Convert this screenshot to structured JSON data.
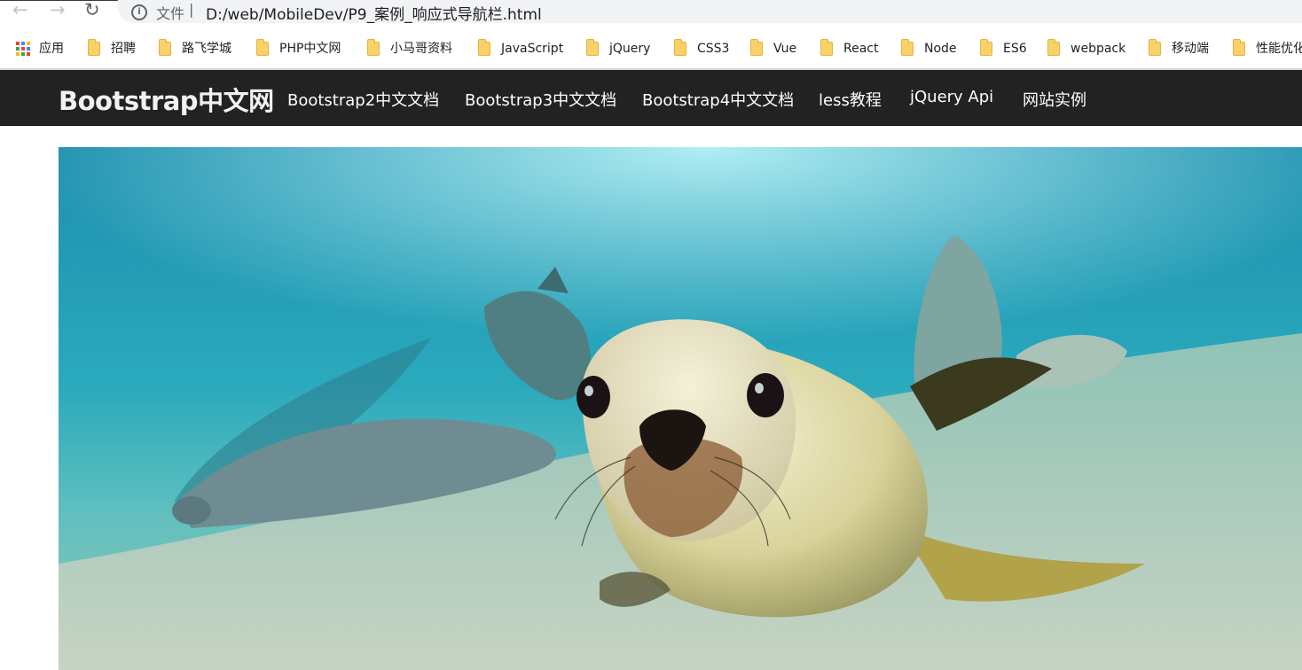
{
  "browser": {
    "address_label": "文件",
    "address_separator": "|",
    "url": "D:/web/MobileDev/P9_案例_响应式导航栏.html"
  },
  "bookmarks": {
    "apps_label": "应用",
    "items": [
      {
        "label": "招聘"
      },
      {
        "label": "路飞学城"
      },
      {
        "label": "PHP中文网"
      },
      {
        "label": "小马哥资料"
      },
      {
        "label": "JavaScript"
      },
      {
        "label": "jQuery"
      },
      {
        "label": "CSS3"
      },
      {
        "label": "Vue"
      },
      {
        "label": "React"
      },
      {
        "label": "Node"
      },
      {
        "label": "ES6"
      },
      {
        "label": "webpack"
      },
      {
        "label": "移动端"
      },
      {
        "label": "性能优化"
      }
    ]
  },
  "navbar": {
    "brand": "Bootstrap中文网",
    "links": [
      {
        "label": "Bootstrap2中文文档"
      },
      {
        "label": "Bootstrap3中文文档"
      },
      {
        "label": "Bootstrap4中文文档"
      },
      {
        "label": "less教程"
      },
      {
        "label": "jQuery Api"
      },
      {
        "label": "网站实例"
      }
    ]
  },
  "colors": {
    "navbar_bg": "#222222",
    "navbar_text": "#ffffff",
    "water_top": "#2ba3bd",
    "water_light": "#8ee3ec",
    "sand": "#b9cfbf",
    "folder": "#f9d169"
  },
  "hero": {
    "image_icon": "sea-lion-photo"
  }
}
